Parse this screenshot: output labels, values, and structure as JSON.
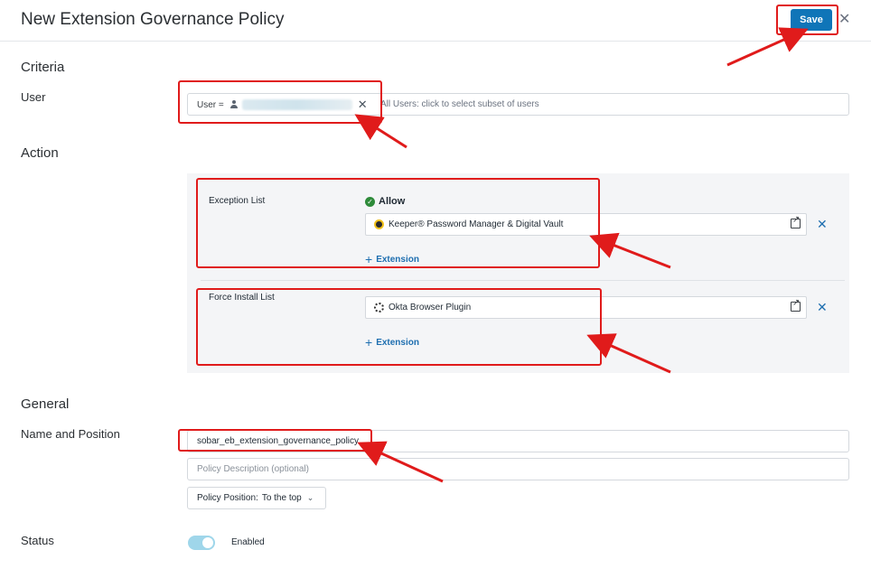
{
  "header": {
    "title": "New Extension Governance Policy",
    "save_label": "Save",
    "close_icon": "close-icon"
  },
  "criteria": {
    "section_title": "Criteria",
    "user_label": "User",
    "user_chip_prefix": "User =",
    "user_placeholder": "All Users: click to select subset of users"
  },
  "action": {
    "section_title": "Action",
    "exception_list": {
      "label": "Exception List",
      "mode": "Allow",
      "extensions": [
        "Keeper® Password Manager & Digital Vault"
      ],
      "add_label": "Extension"
    },
    "force_install_list": {
      "label": "Force Install List",
      "extensions": [
        "Okta Browser Plugin"
      ],
      "add_label": "Extension"
    }
  },
  "general": {
    "section_title": "General",
    "name_label": "Name and Position",
    "name_value": "sobar_eb_extension_governance_policy",
    "description_placeholder": "Policy Description (optional)",
    "position_label": "Policy Position:",
    "position_value": "To the top"
  },
  "status": {
    "label": "Status",
    "toggle_label": "Enabled",
    "enabled": true
  },
  "colors": {
    "primary": "#0f75b8",
    "annotation": "#e01b1b",
    "allow_green": "#2e8b3a"
  }
}
